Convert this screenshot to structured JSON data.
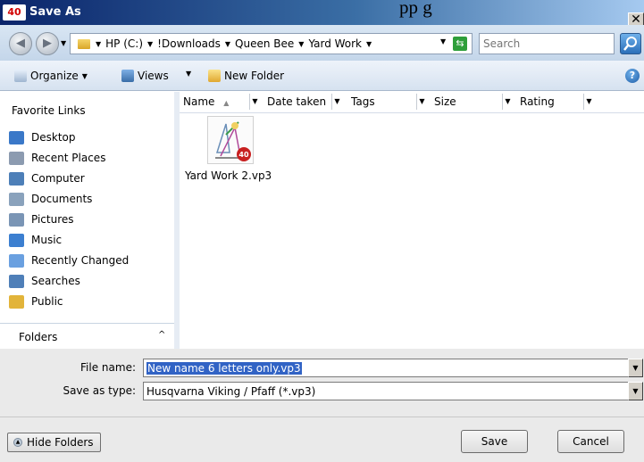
{
  "window": {
    "title": "Save As",
    "title_icon": "40",
    "background_text": "pp            g",
    "close_glyph": "✕"
  },
  "navigation": {
    "back_glyph": "◀",
    "forward_glyph": "▶",
    "breadcrumbs": [
      "HP (C:)",
      "!Downloads",
      "Queen Bee",
      "Yard Work"
    ],
    "search_placeholder": "Search"
  },
  "toolbar": {
    "organize": "Organize",
    "views": "Views",
    "new_folder": "New Folder",
    "help": "?"
  },
  "favorites": {
    "title": "Favorite Links",
    "items": [
      {
        "label": "Desktop",
        "icon": "desktop-icon",
        "color": "#3a78c8"
      },
      {
        "label": "Recent Places",
        "icon": "recent-places-icon",
        "color": "#8c9bb0"
      },
      {
        "label": "Computer",
        "icon": "computer-icon",
        "color": "#4d7fb8"
      },
      {
        "label": "Documents",
        "icon": "documents-icon",
        "color": "#8aa2bc"
      },
      {
        "label": "Pictures",
        "icon": "pictures-icon",
        "color": "#7a95b5"
      },
      {
        "label": "Music",
        "icon": "music-icon",
        "color": "#3c7fd0"
      },
      {
        "label": "Recently Changed",
        "icon": "recently-changed-icon",
        "color": "#6aa0e0"
      },
      {
        "label": "Searches",
        "icon": "searches-icon",
        "color": "#4f7fb8"
      },
      {
        "label": "Public",
        "icon": "public-folder-icon",
        "color": "#e2b43a"
      }
    ],
    "folders_label": "Folders",
    "folders_caret": "^"
  },
  "columns": {
    "name": "Name",
    "sort_glyph": "▲",
    "date_taken": "Date taken",
    "tags": "Tags",
    "size": "Size",
    "rating": "Rating"
  },
  "files": [
    {
      "name": "Yard Work 2.vp3"
    }
  ],
  "form": {
    "file_name_label": "File name:",
    "file_name_value": "New name 6 letters only.vp3",
    "save_as_type_label": "Save as type:",
    "save_as_type_value": "Husqvarna Viking / Pfaff (*.vp3)"
  },
  "buttons": {
    "hide_folders": "Hide Folders",
    "save": "Save",
    "cancel": "Cancel"
  },
  "colors": {
    "titlebar_start": "#0a246a",
    "selection": "#3163c5"
  }
}
